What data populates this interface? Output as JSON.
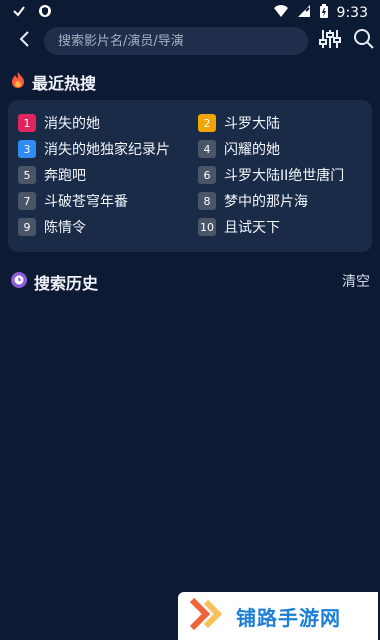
{
  "status": {
    "time": "9:33",
    "icons": [
      "check-icon",
      "shield-icon",
      "wifi-icon",
      "signal-icon",
      "battery-icon"
    ]
  },
  "search": {
    "placeholder": "搜索影片名/演员/导演",
    "back_icon": "back-arrow-icon",
    "filter_icon": "filter-sliders-icon",
    "search_icon": "search-icon"
  },
  "hot": {
    "title": "最近热搜",
    "title_icon": "flame-icon",
    "items": [
      {
        "rank": "1",
        "title": "消失的她",
        "color": "#e0245e"
      },
      {
        "rank": "2",
        "title": "斗罗大陆",
        "color": "#f0a500"
      },
      {
        "rank": "3",
        "title": "消失的她独家纪录片",
        "color": "#2f8cf3"
      },
      {
        "rank": "4",
        "title": "闪耀的她",
        "color": "#4a5668"
      },
      {
        "rank": "5",
        "title": "奔跑吧",
        "color": "#4a5668"
      },
      {
        "rank": "6",
        "title": "斗罗大陆II绝世唐门",
        "color": "#4a5668"
      },
      {
        "rank": "7",
        "title": "斗破苍穹年番",
        "color": "#4a5668"
      },
      {
        "rank": "8",
        "title": "梦中的那片海",
        "color": "#4a5668"
      },
      {
        "rank": "9",
        "title": "陈情令",
        "color": "#4a5668"
      },
      {
        "rank": "10",
        "title": "且试天下",
        "color": "#4a5668"
      }
    ]
  },
  "history": {
    "title": "搜索历史",
    "title_icon": "history-icon",
    "clear_label": "清空"
  },
  "watermark": {
    "text": "铺路手游网",
    "logo_icon": "chevron-logo-icon"
  },
  "colors": {
    "background": "#0d1a33",
    "card": "#1a2b47",
    "search_box": "#1f2f4b"
  }
}
